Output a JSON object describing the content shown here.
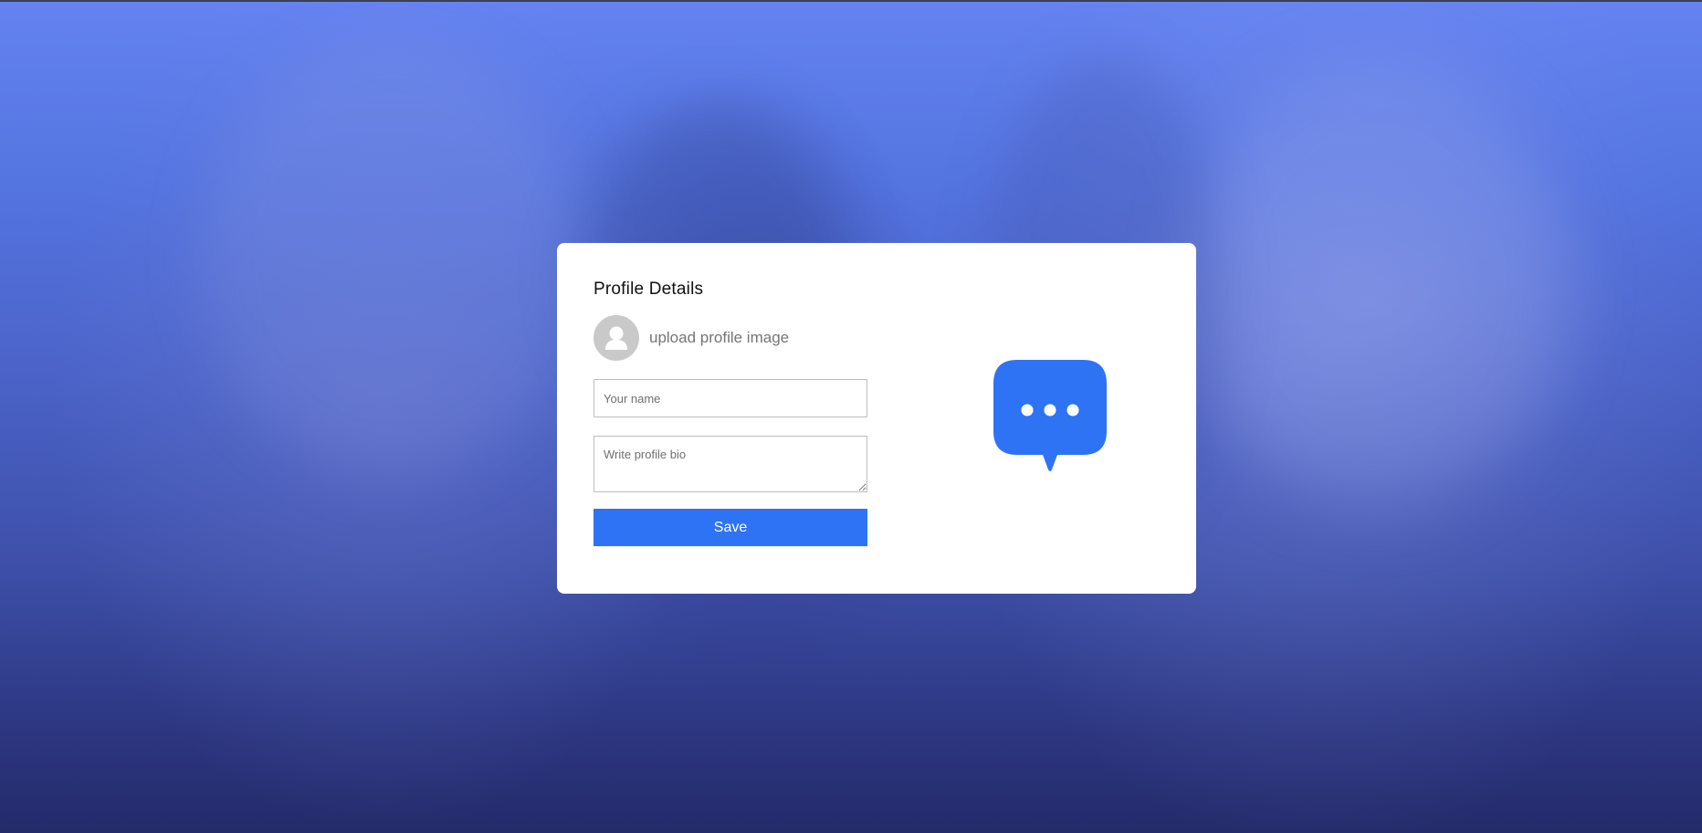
{
  "form": {
    "title": "Profile Details",
    "upload_label": "upload profile image",
    "name_placeholder": "Your name",
    "name_value": "",
    "bio_placeholder": "Write profile bio",
    "bio_value": "",
    "save_label": "Save"
  },
  "colors": {
    "accent": "#2f73f5",
    "avatar_bg": "#c9c9c9",
    "background_top": "#6483f1",
    "background_bottom": "#242b6a"
  },
  "icons": {
    "avatar": "user-silhouette-icon",
    "chat": "chat-bubble-dots-icon"
  }
}
